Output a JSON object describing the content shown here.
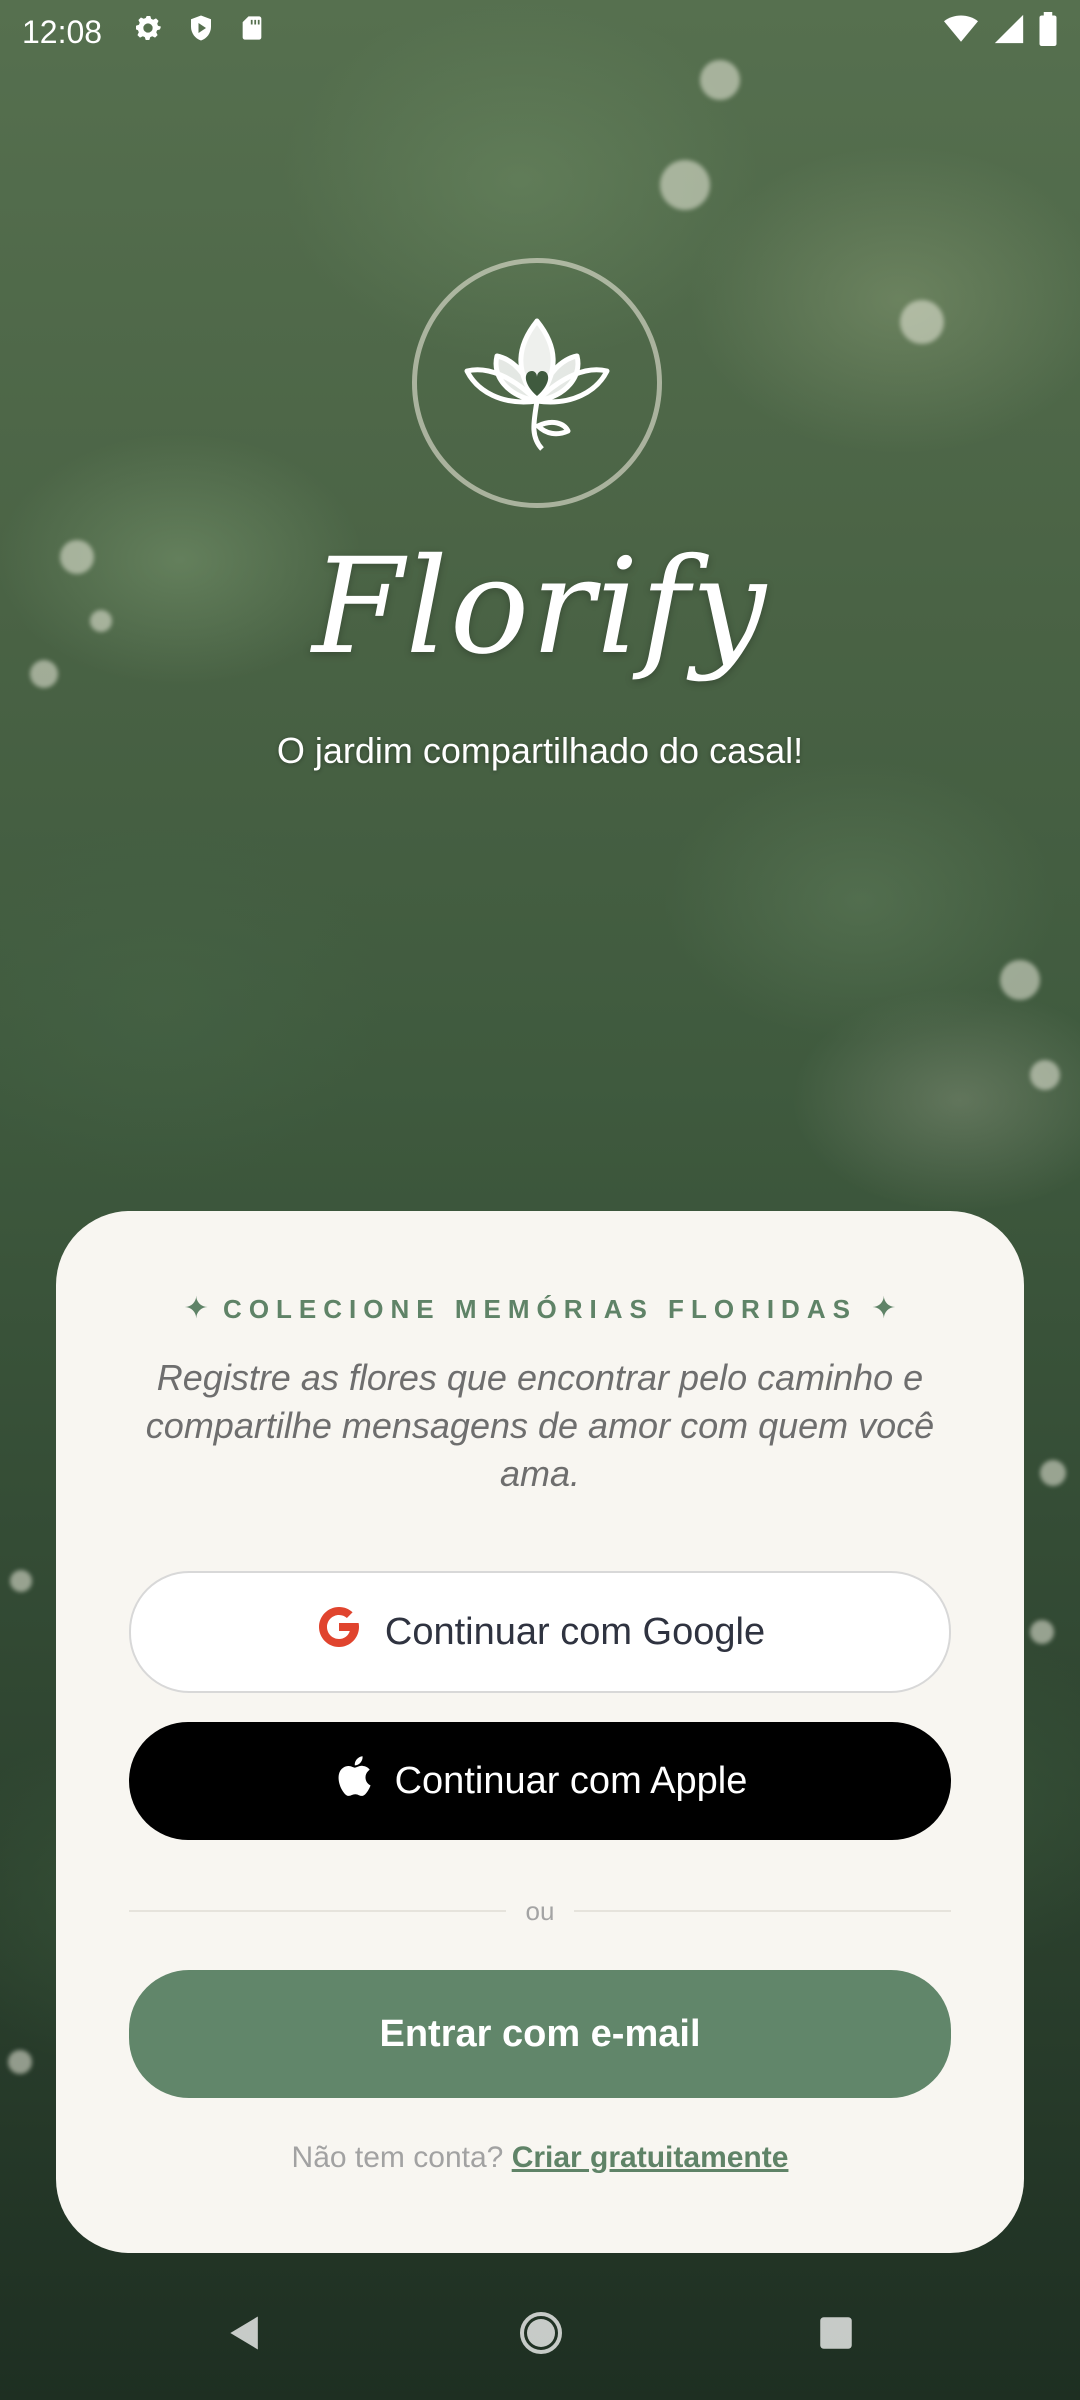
{
  "status_bar": {
    "time": "12:08",
    "left_icons": [
      "settings-icon",
      "shield-play-icon",
      "sd-card-icon"
    ],
    "right_icons": [
      "wifi-icon",
      "signal-icon",
      "battery-icon"
    ]
  },
  "app": {
    "name": "Florify",
    "tagline": "O jardim compartilhado do casal!",
    "logo_icon": "lotus-heart-icon"
  },
  "card": {
    "kicker": "COLECIONE MEMÓRIAS FLORIDAS",
    "description": "Registre as flores que encontrar pelo caminho e compartilhe mensagens de amor com quem você ama.",
    "google_button": "Continuar com Google",
    "apple_button": "Continuar com Apple",
    "divider_text": "ou",
    "email_button": "Entrar com e-mail",
    "signup_prompt": "Não tem conta?",
    "signup_link": "Criar gratuitamente"
  },
  "colors": {
    "accent_green": "#61866a",
    "card_bg": "#f8f6f1",
    "google_red": "#e0442e"
  },
  "nav_bar": [
    "back-icon",
    "home-icon",
    "recents-icon"
  ]
}
